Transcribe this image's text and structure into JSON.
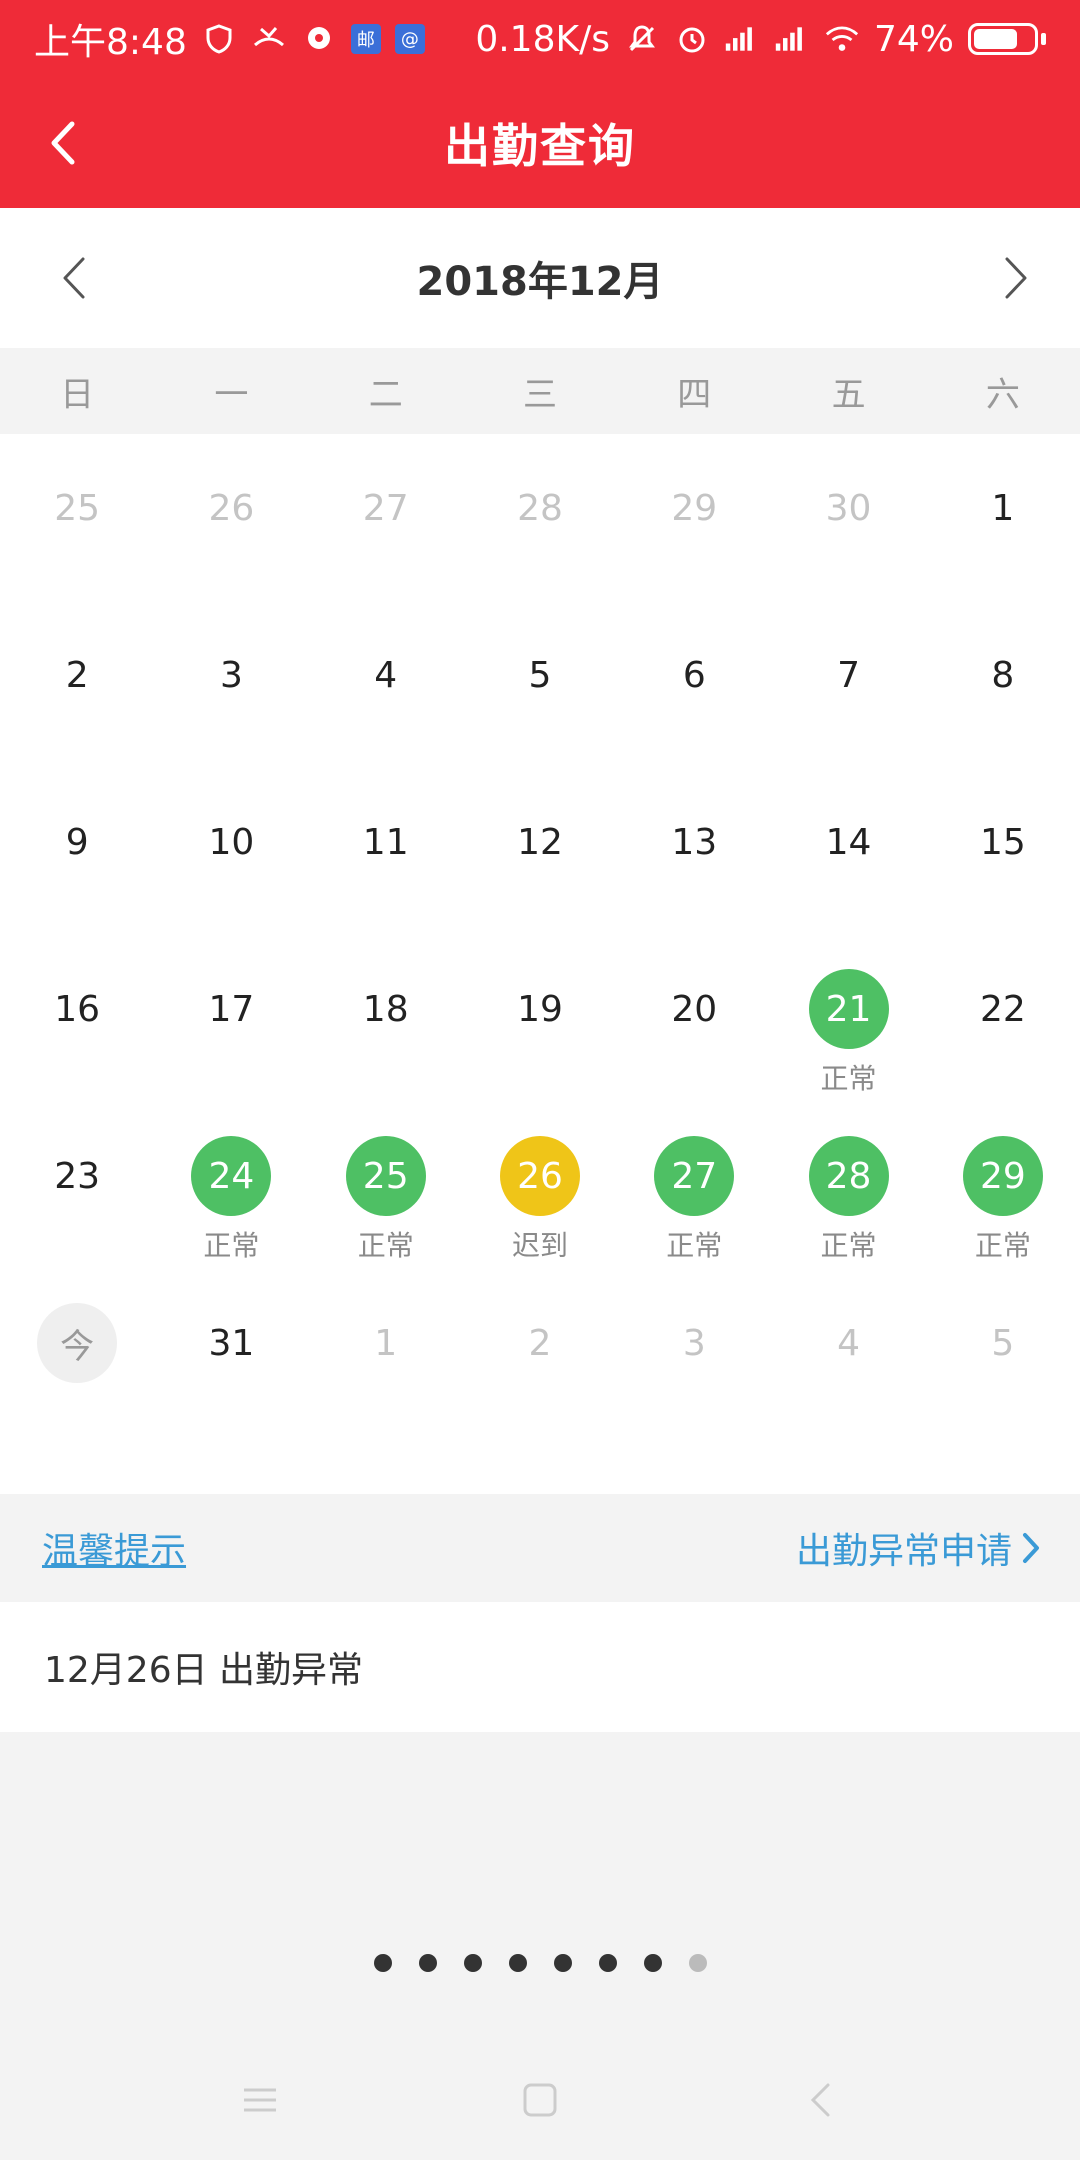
{
  "status_bar": {
    "time": "上午8:48",
    "net_speed": "0.18K/s",
    "battery": "74%",
    "battery_level": 0.74,
    "notif_badge_1": "邮",
    "notif_badge_2": "@"
  },
  "app_bar": {
    "title": "出勤查询"
  },
  "calendar": {
    "month_title": "2018年12月",
    "weekdays": [
      "日",
      "一",
      "二",
      "三",
      "四",
      "五",
      "六"
    ],
    "weeks": [
      [
        {
          "day": "25",
          "type": "muted"
        },
        {
          "day": "26",
          "type": "muted"
        },
        {
          "day": "27",
          "type": "muted"
        },
        {
          "day": "28",
          "type": "muted"
        },
        {
          "day": "29",
          "type": "muted"
        },
        {
          "day": "30",
          "type": "muted"
        },
        {
          "day": "1",
          "type": "plain"
        }
      ],
      [
        {
          "day": "2",
          "type": "plain"
        },
        {
          "day": "3",
          "type": "plain"
        },
        {
          "day": "4",
          "type": "plain"
        },
        {
          "day": "5",
          "type": "plain"
        },
        {
          "day": "6",
          "type": "plain"
        },
        {
          "day": "7",
          "type": "plain"
        },
        {
          "day": "8",
          "type": "plain"
        }
      ],
      [
        {
          "day": "9",
          "type": "plain"
        },
        {
          "day": "10",
          "type": "plain"
        },
        {
          "day": "11",
          "type": "plain"
        },
        {
          "day": "12",
          "type": "plain"
        },
        {
          "day": "13",
          "type": "plain"
        },
        {
          "day": "14",
          "type": "plain"
        },
        {
          "day": "15",
          "type": "plain"
        }
      ],
      [
        {
          "day": "16",
          "type": "plain"
        },
        {
          "day": "17",
          "type": "plain"
        },
        {
          "day": "18",
          "type": "plain"
        },
        {
          "day": "19",
          "type": "plain"
        },
        {
          "day": "20",
          "type": "plain"
        },
        {
          "day": "21",
          "type": "normal",
          "status": "正常"
        },
        {
          "day": "22",
          "type": "plain"
        }
      ],
      [
        {
          "day": "23",
          "type": "plain"
        },
        {
          "day": "24",
          "type": "normal",
          "status": "正常"
        },
        {
          "day": "25",
          "type": "normal",
          "status": "正常"
        },
        {
          "day": "26",
          "type": "late",
          "status": "迟到"
        },
        {
          "day": "27",
          "type": "normal",
          "status": "正常"
        },
        {
          "day": "28",
          "type": "normal",
          "status": "正常"
        },
        {
          "day": "29",
          "type": "normal",
          "status": "正常"
        }
      ],
      [
        {
          "day": "今",
          "type": "today"
        },
        {
          "day": "31",
          "type": "plain"
        },
        {
          "day": "1",
          "type": "muted"
        },
        {
          "day": "2",
          "type": "muted"
        },
        {
          "day": "3",
          "type": "muted"
        },
        {
          "day": "4",
          "type": "muted"
        },
        {
          "day": "5",
          "type": "muted"
        }
      ]
    ]
  },
  "tips": {
    "tips_label": "温馨提示",
    "apply_label": "出勤异常申请"
  },
  "notice": {
    "text": "12月26日 出勤异常"
  },
  "pager": {
    "total": 8,
    "active_index": 7
  },
  "colors": {
    "brand_red": "#ef2b38",
    "normal_green": "#4ec064",
    "late_yellow": "#efc518",
    "link_blue": "#3a9ad6"
  }
}
